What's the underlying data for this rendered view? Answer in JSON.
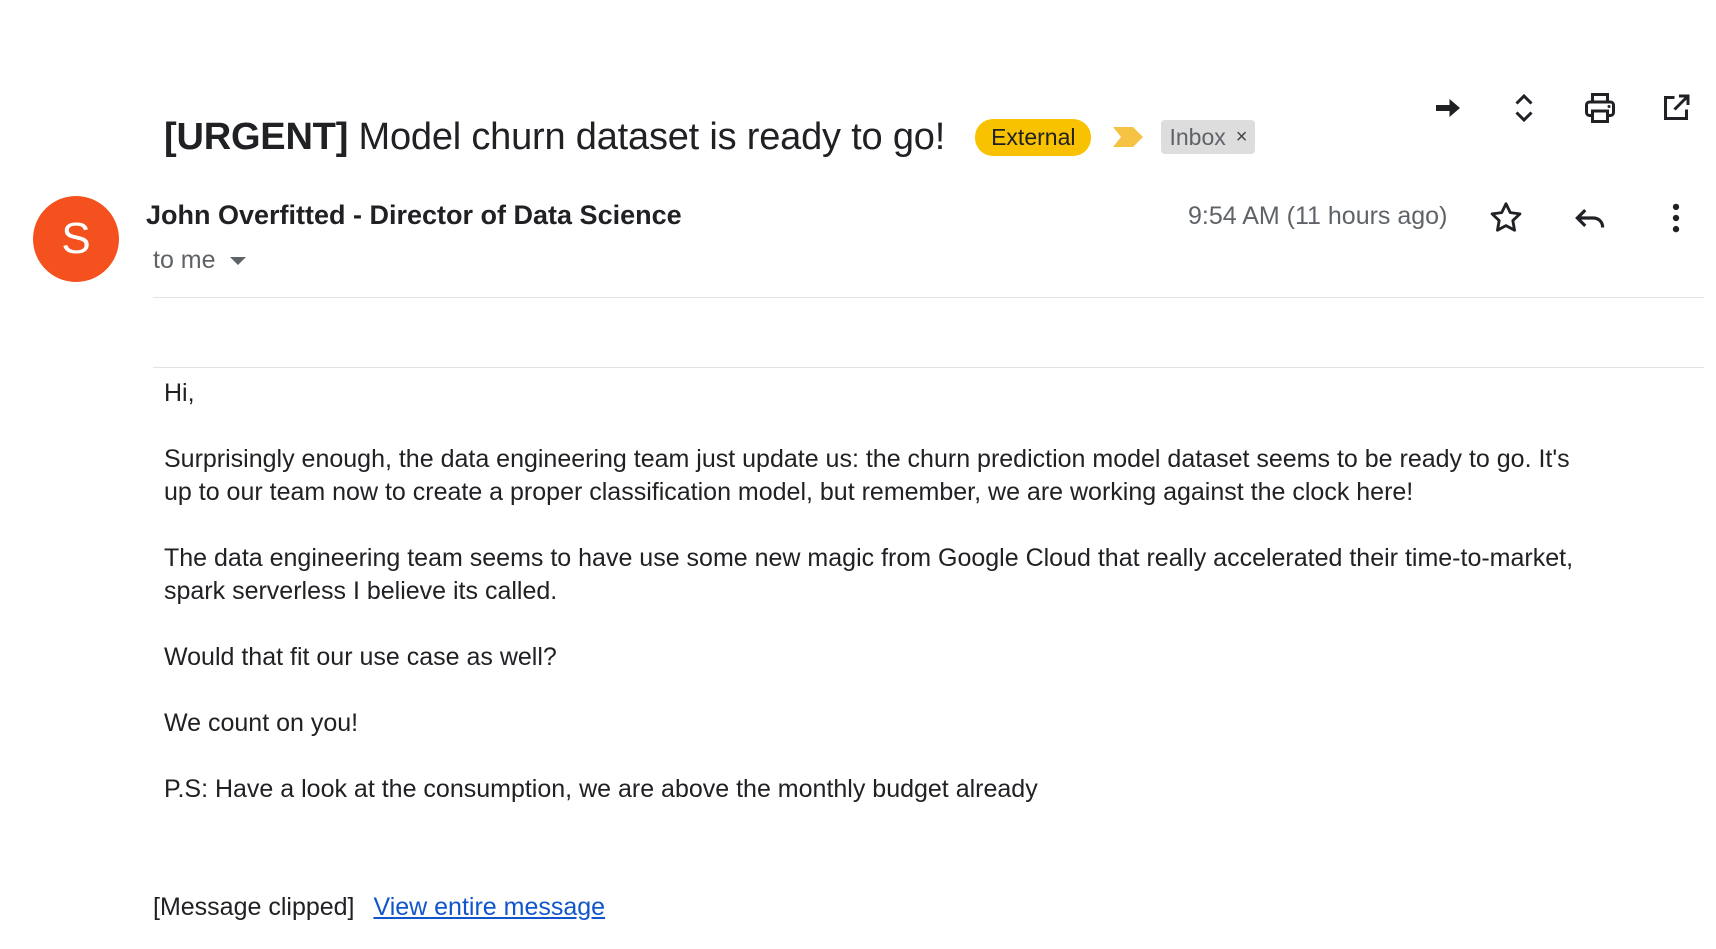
{
  "toolbar": {
    "icons": [
      "forward-arrow-icon",
      "expand-collapse-icon",
      "print-icon",
      "open-in-new-window-icon"
    ]
  },
  "subject": {
    "tag": "[URGENT]",
    "text": " Model churn dataset is ready to go!",
    "external_label": "External",
    "importance_color": "#f6c244",
    "inbox_label": "Inbox",
    "inbox_remove": "×"
  },
  "sender": {
    "avatar_letter": "S",
    "avatar_color": "#f4511e",
    "name": "John Overfitted - Director of Data Science",
    "recipient": "to me",
    "timestamp": "9:54 AM (11 hours ago)"
  },
  "body": {
    "paragraphs": [
      "Hi,",
      "Surprisingly enough, the data engineering team just update us: the churn prediction model dataset seems to be ready to go. It's up to our team now to create a proper classification model, but remember, we are working against the clock here!",
      "The data engineering team seems to have use some new magic from Google Cloud that really accelerated their time-to-market, spark serverless I believe its called.",
      "Would that fit our use case as well?",
      "We count on you!",
      "P.S: Have a look at the consumption, we are above the monthly budget already"
    ]
  },
  "footer": {
    "clipped_text": "[Message clipped]",
    "view_link": "View entire message",
    "link_color": "#1155cc"
  }
}
